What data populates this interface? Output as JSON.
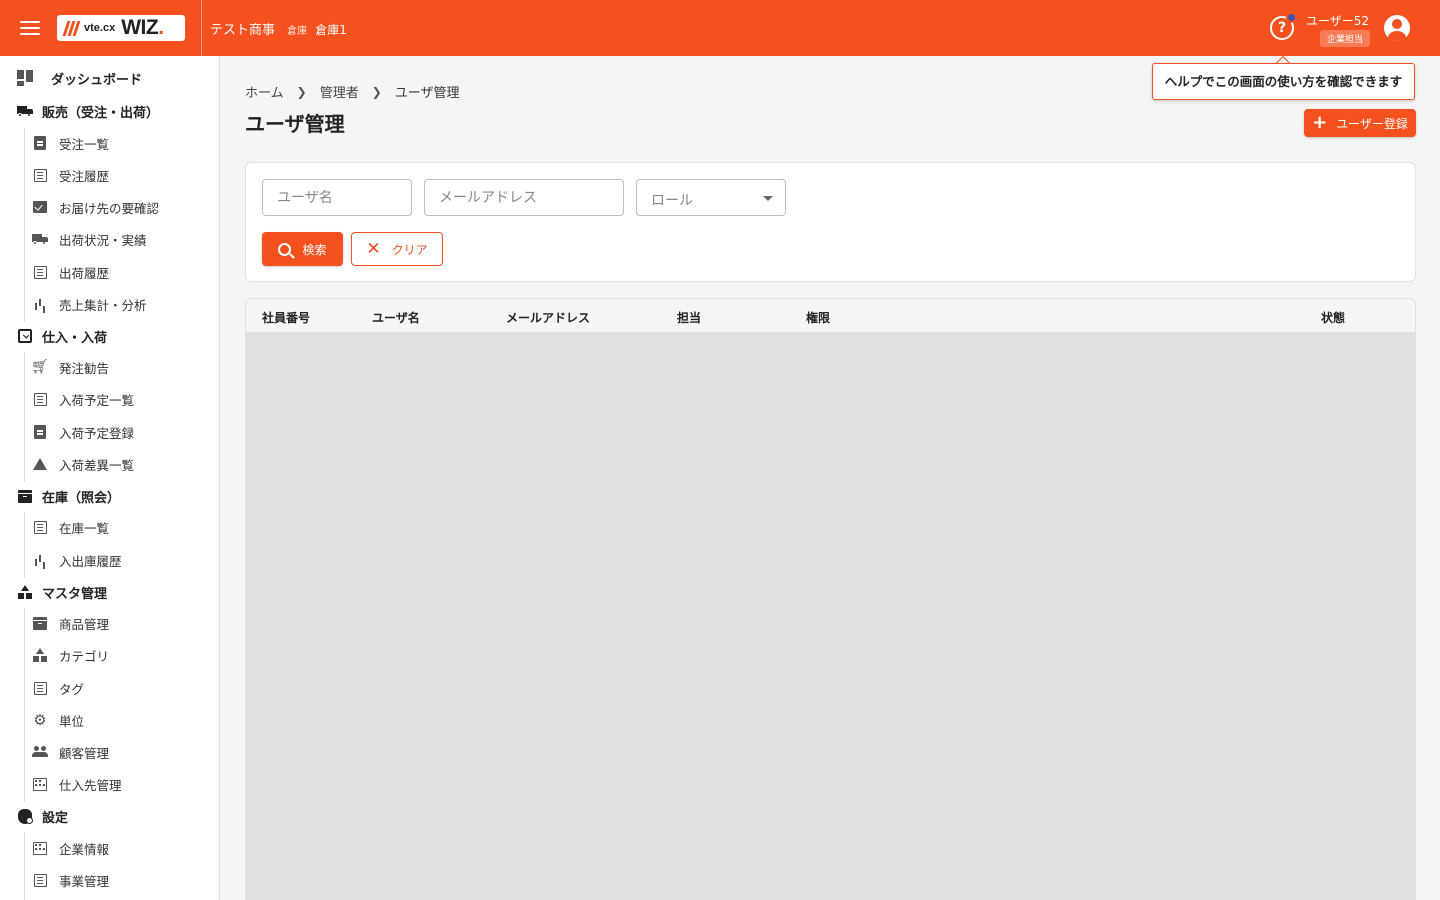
{
  "header": {
    "logo_small": "vte.cx",
    "logo_big": "WIZ",
    "company": "テスト商事",
    "warehouse_label": "倉庫",
    "warehouse": "倉庫1",
    "help_icon": "help-circle-icon",
    "user_name": "ユーザー52",
    "user_role": "企業担当",
    "colors": {
      "brand": "#f4511e",
      "notification": "#3f51b5"
    }
  },
  "tooltip": {
    "text": "ヘルプでこの画面の使い方を確認できます"
  },
  "sidebar": {
    "dashboard": "ダッシュボード",
    "sales": {
      "label": "販売（受注・出荷）",
      "items": [
        "受注一覧",
        "受注履歴",
        "お届け先の要確認",
        "出荷状況・実績",
        "出荷履歴",
        "売上集計・分析"
      ]
    },
    "purchase": {
      "label": "仕入・入荷",
      "items": [
        "発注勧告",
        "入荷予定一覧",
        "入荷予定登録",
        "入荷差異一覧"
      ]
    },
    "stock": {
      "label": "在庫（照会）",
      "items": [
        "在庫一覧",
        "入出庫履歴"
      ]
    },
    "master": {
      "label": "マスタ管理",
      "items": [
        "商品管理",
        "カテゴリ",
        "タグ",
        "単位",
        "顧客管理",
        "仕入先管理"
      ]
    },
    "settings": {
      "label": "設定",
      "items": [
        "企業情報",
        "事業管理"
      ]
    }
  },
  "breadcrumb": [
    "ホーム",
    "管理者",
    "ユーザ管理"
  ],
  "page_title": "ユーザ管理",
  "add_button": "ユーザー登録",
  "filters": {
    "username_placeholder": "ユーザ名",
    "email_placeholder": "メールアドレス",
    "role_placeholder": "ロール",
    "search_button": "検索",
    "clear_button": "クリア"
  },
  "table": {
    "columns": [
      "社員番号",
      "ユーザ名",
      "メールアドレス",
      "担当",
      "権限",
      "状態"
    ],
    "rows": []
  }
}
